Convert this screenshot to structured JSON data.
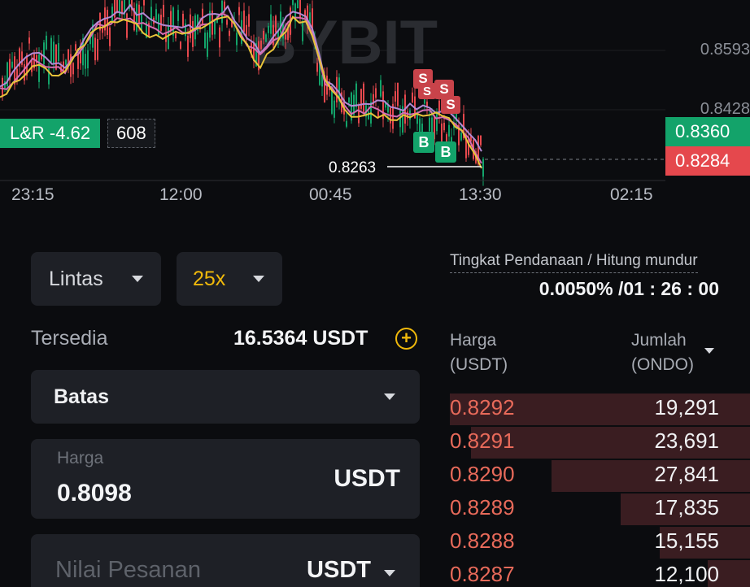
{
  "chart": {
    "watermark": "BYBIT",
    "price_axis": [
      "0.8593",
      "0.8428"
    ],
    "time_axis": [
      "23:15",
      "12:00",
      "00:45",
      "13:30",
      "02:15"
    ],
    "lr_label": "L&R -4.62",
    "lr_value": "608",
    "last_price_tag": "0.8360",
    "mark_price_tag": "0.8284",
    "low_marker": "0.8263",
    "marker_sell": "S",
    "marker_buy": "B",
    "colors": {
      "up": "#13a36a",
      "down": "#e5484d",
      "ma_yellow": "#e8c43a",
      "ma_purple": "#b48ad6",
      "ma_pink": "#d66fb3"
    }
  },
  "order_panel": {
    "margin_mode": "Lintas",
    "leverage": "25x",
    "available_label": "Tersedia",
    "available_value": "16.5364 USDT",
    "order_type": "Batas",
    "price_label": "Harga",
    "price_value": "0.8098",
    "price_unit": "USDT",
    "order_value_placeholder": "Nilai Pesanan",
    "order_value_unit": "USDT"
  },
  "funding": {
    "label": "Tingkat Pendanaan / Hitung mundur",
    "value": "0.0050% /01 : 26 : 00"
  },
  "order_book": {
    "price_header": "Harga",
    "price_unit": "(USDT)",
    "amount_header": "Jumlah",
    "amount_unit": "(ONDO)",
    "asks": [
      {
        "price": "0.8292",
        "amount": "19,291",
        "depth": 1.0
      },
      {
        "price": "0.8291",
        "amount": "23,691",
        "depth": 0.93
      },
      {
        "price": "0.8290",
        "amount": "27,841",
        "depth": 0.66
      },
      {
        "price": "0.8289",
        "amount": "17,835",
        "depth": 0.43
      },
      {
        "price": "0.8288",
        "amount": "15,155",
        "depth": 0.3
      },
      {
        "price": "0.8287",
        "amount": "12,100",
        "depth": 0.14
      }
    ]
  }
}
